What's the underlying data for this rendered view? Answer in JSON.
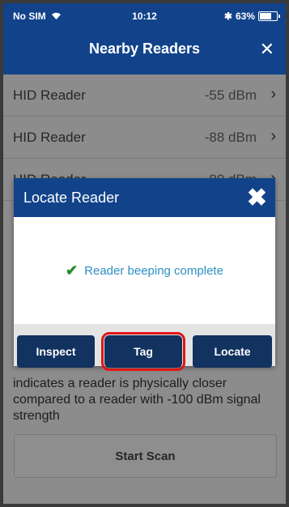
{
  "status_bar": {
    "carrier": "No SIM",
    "wifi_icon": "wifi-icon",
    "time": "10:12",
    "bluetooth_icon": "bluetooth-icon",
    "battery_percent": "63%",
    "battery_level": 0.63
  },
  "nav": {
    "title": "Nearby Readers",
    "close_glyph": "✕"
  },
  "readers": [
    {
      "name": "HID Reader",
      "rssi": "-55 dBm"
    },
    {
      "name": "HID Reader",
      "rssi": "-88 dBm"
    },
    {
      "name": "HID Reader",
      "rssi": "-89 dBm"
    }
  ],
  "modal": {
    "title": "Locate Reader",
    "close_glyph": "✖",
    "message": "Reader beeping complete",
    "buttons": {
      "inspect": "Inspect",
      "tag": "Tag",
      "locate": "Locate"
    }
  },
  "info_text": "indicates a reader is physically closer compared to a reader with -100 dBm signal strength",
  "scan_button": "Start Scan",
  "colors": {
    "header_blue": "#12438a",
    "button_navy": "#12325f",
    "highlight_red": "#e01616",
    "message_blue": "#2d8fc4",
    "check_green": "#2a8a2a"
  }
}
